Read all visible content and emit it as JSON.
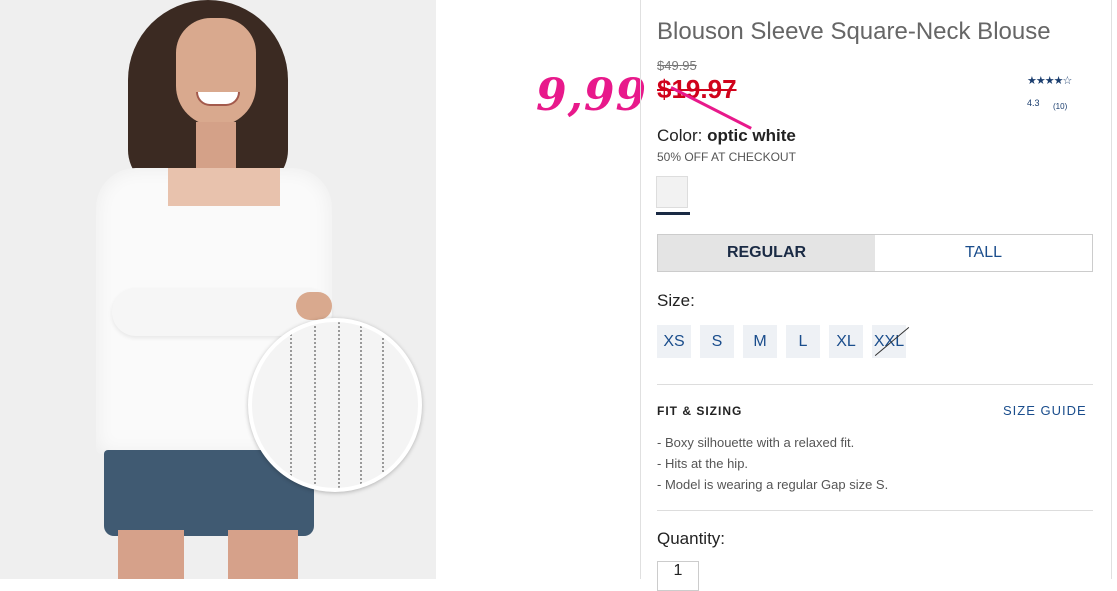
{
  "annotation": {
    "handwritten_price": "9,99"
  },
  "product": {
    "title": "Blouson Sleeve Square-Neck Blouse",
    "original_price": "$49.95",
    "sale_price": "$19.97",
    "rating": {
      "stars_text": "★★★★☆",
      "value": "4.3",
      "count": "(10)"
    },
    "color_label": "Color:",
    "color_value": "optic white",
    "promo": "50% OFF AT CHECKOUT",
    "fit_options": [
      "REGULAR",
      "TALL"
    ],
    "selected_fit": "REGULAR",
    "size_label": "Size:",
    "sizes": [
      "XS",
      "S",
      "M",
      "L",
      "XL",
      "XXL"
    ],
    "out_of_stock_sizes": [
      "XXL"
    ],
    "fit_section": {
      "title": "FIT & SIZING",
      "guide_link": "SIZE GUIDE",
      "bullets": [
        "- Boxy silhouette with a relaxed fit.",
        "- Hits at the hip.",
        "- Model is wearing a regular Gap size S."
      ]
    },
    "quantity_label": "Quantity:",
    "quantity_value": "1"
  },
  "colors": {
    "sale_red": "#d0021b",
    "link_blue": "#1a4d8c",
    "annotation_pink": "#e8198b"
  }
}
